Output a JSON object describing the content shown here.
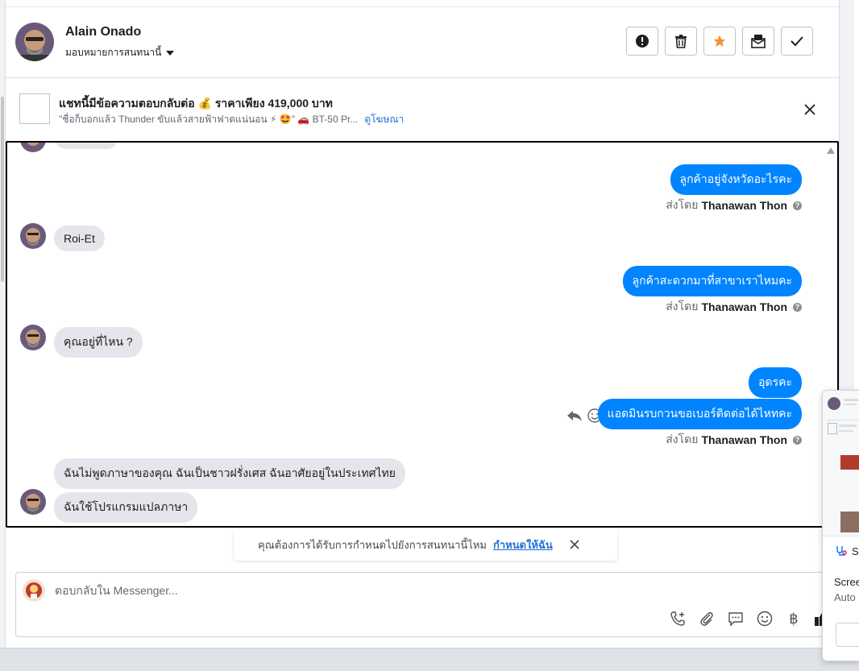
{
  "header": {
    "name": "Alain Onado",
    "assign_label": "มอบหมายการสนทนานี้",
    "tools": [
      {
        "icon": "alert-icon",
        "label": "spam"
      },
      {
        "icon": "trash-icon",
        "label": "delete"
      },
      {
        "icon": "star-icon",
        "label": "follow-up",
        "color": "#f7923b"
      },
      {
        "icon": "mark-unread-icon",
        "label": "mark-unread"
      },
      {
        "icon": "check-icon",
        "label": "done"
      }
    ]
  },
  "ad": {
    "title": "แชทนี้มีข้อความตอบกลับต่อ 💰 ราคาเพียง 419,000 บาท",
    "subtitle": "\"ชื่อก็บอกแล้ว Thunder ขับแล้วสายฟ้าฟาดแน่นอน ⚡ 🤩\" 🚗 BT-50 Pr...",
    "link": "ดูโฆษณา"
  },
  "messages": [
    {
      "dir": "out",
      "text": "ลูกค้าอยู่จังหวัดอะไรคะ"
    },
    {
      "dir": "sent_by",
      "prefix": "ส่งโดย",
      "agent": "Thanawan Thon"
    },
    {
      "dir": "in",
      "text": "Roi-Et"
    },
    {
      "dir": "out",
      "text": "ลูกค้าสะดวกมาที่สาขาเราไหมคะ"
    },
    {
      "dir": "sent_by",
      "prefix": "ส่งโดย",
      "agent": "Thanawan Thon"
    },
    {
      "dir": "in",
      "text": "คุณอยู่ที่ไหน ?"
    },
    {
      "dir": "out",
      "text": "อุดรคะ"
    },
    {
      "dir": "out",
      "text": "แอดมินรบกวนขอเบอร์ติดต่อได้ไหทคะ"
    },
    {
      "dir": "sent_by",
      "prefix": "ส่งโดย",
      "agent": "Thanawan Thon"
    },
    {
      "dir": "in",
      "text": "ฉันไม่พูดภาษาของคุณ ฉันเป็นชาวฝรั่งเศส ฉันอาศัยอยู่ในประเทศไทย"
    },
    {
      "dir": "in",
      "text": "ฉันใช้โปรแกรมแปลภาษา"
    }
  ],
  "toast": {
    "text": "คุณต้องการได้รับการกำหนดไปยังการสนทนานี้ไหม",
    "link": "กำหนดให้ฉัน"
  },
  "composer": {
    "placeholder": "ตอบกลับใน Messenger...",
    "currency_symbol": "฿"
  },
  "widget": {
    "label_1": "Scree",
    "label_2": "Auto",
    "icon_letter": "S"
  }
}
